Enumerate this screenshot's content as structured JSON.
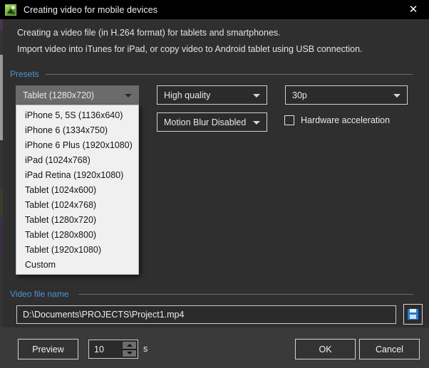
{
  "window": {
    "title": "Creating video for mobile devices",
    "icon": "video-app-icon",
    "close_label": "✕"
  },
  "description": {
    "line1": "Creating a video file (in H.264 format) for tablets and smartphones.",
    "line2": "Import video into iTunes for iPad, or copy video to Android tablet using USB connection."
  },
  "presets": {
    "group_label": "Presets",
    "preset_combo": {
      "selected": "Tablet (1280x720)",
      "expanded": true,
      "options": [
        "iPhone 5, 5S (1136x640)",
        "iPhone 6 (1334x750)",
        "iPhone 6 Plus (1920x1080)",
        "iPad (1024x768)",
        "iPad Retina (1920x1080)",
        "Tablet (1024x600)",
        "Tablet (1024x768)",
        "Tablet (1280x720)",
        "Tablet (1280x800)",
        "Tablet (1920x1080)",
        "Custom"
      ]
    },
    "quality_combo": {
      "selected": "High quality"
    },
    "fps_combo": {
      "selected": "30p"
    },
    "motion_blur_combo": {
      "selected": "Motion Blur Disabled"
    },
    "hardware_acceleration": {
      "label": "Hardware acceleration",
      "checked": false
    }
  },
  "video_file": {
    "group_label": "Video file name",
    "path": "D:\\Documents\\PROJECTS\\Project1.mp4",
    "save_icon": "floppy-disk-icon"
  },
  "footer": {
    "preview_label": "Preview",
    "duration_value": "10",
    "duration_unit": "s",
    "ok_label": "OK",
    "cancel_label": "Cancel"
  },
  "colors": {
    "accent_blue": "#4a96d8",
    "window_bg": "#2f2f2f",
    "titlebar_bg": "#000000",
    "footer_bg": "#3a3a3a",
    "save_icon_blue": "#1f7ddb"
  }
}
